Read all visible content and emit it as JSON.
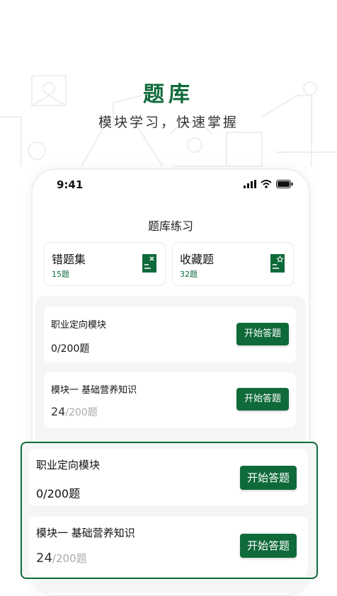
{
  "header": {
    "title": "题库",
    "subtitle": "模块学习，快速掌握"
  },
  "status_bar": {
    "time": "9:41"
  },
  "screen": {
    "title": "题库练习"
  },
  "quick_cards": [
    {
      "title": "错题集",
      "count": "15题",
      "icon": "wrong-questions-icon"
    },
    {
      "title": "收藏题",
      "count": "32题",
      "icon": "favorites-icon"
    }
  ],
  "modules": [
    {
      "name": "职业定向模块",
      "progress": "0/200题",
      "button": "开始答题"
    },
    {
      "name": "模块一 基础营养知识",
      "done": "24",
      "total": "/200题",
      "button": "开始答题"
    }
  ],
  "popout_modules": [
    {
      "name": "职业定向模块",
      "progress": "0/200题",
      "button": "开始答题"
    },
    {
      "name": "模块一 基础营养知识",
      "done": "24",
      "total": "/200题",
      "button": "开始答题"
    }
  ],
  "colors": {
    "accent": "#0f6a3a",
    "muted": "#aaaaaa",
    "panel": "#f4f6f5"
  }
}
